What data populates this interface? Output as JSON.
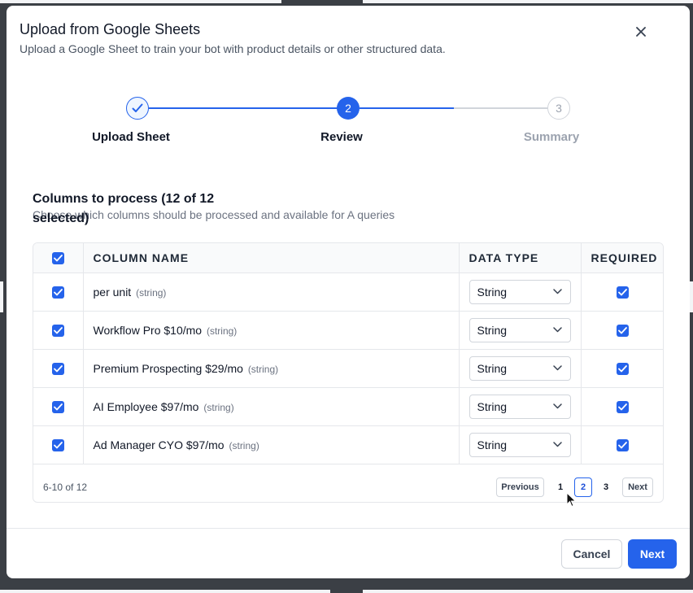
{
  "modal": {
    "title": "Upload from Google Sheets",
    "subtitle": "Upload a Google Sheet to train your bot with product details or other structured data."
  },
  "stepper": {
    "steps": [
      {
        "number": "1",
        "label": "Upload Sheet",
        "state": "complete"
      },
      {
        "number": "2",
        "label": "Review",
        "state": "current"
      },
      {
        "number": "3",
        "label": "Summary",
        "state": "upcoming"
      }
    ]
  },
  "section": {
    "title": "Columns to process (12 of 12 selected)",
    "description": "Choose which columns should be processed and available for A queries"
  },
  "table": {
    "headers": {
      "column_name": "COLUMN NAME",
      "data_type": "DATA TYPE",
      "required": "REQUIRED"
    },
    "rows": [
      {
        "name": "per unit",
        "hint": "(string)",
        "type": "String",
        "selected": true,
        "required": true
      },
      {
        "name": "Workflow Pro $10/mo",
        "hint": "(string)",
        "type": "String",
        "selected": true,
        "required": true
      },
      {
        "name": "Premium Prospecting $29/mo",
        "hint": "(string)",
        "type": "String",
        "selected": true,
        "required": true
      },
      {
        "name": "AI Employee $97/mo",
        "hint": "(string)",
        "type": "String",
        "selected": true,
        "required": true
      },
      {
        "name": "Ad Manager CYO $97/mo",
        "hint": "(string)",
        "type": "String",
        "selected": true,
        "required": true
      }
    ]
  },
  "pagination": {
    "range_text": "6-10 of 12",
    "previous_label": "Previous",
    "next_label": "Next",
    "pages": [
      "1",
      "2",
      "3"
    ],
    "current_page": "2"
  },
  "footer": {
    "cancel_label": "Cancel",
    "next_label": "Next"
  },
  "colors": {
    "primary": "#2563eb",
    "muted": "#9ca3af",
    "border": "#e5e7eb"
  }
}
